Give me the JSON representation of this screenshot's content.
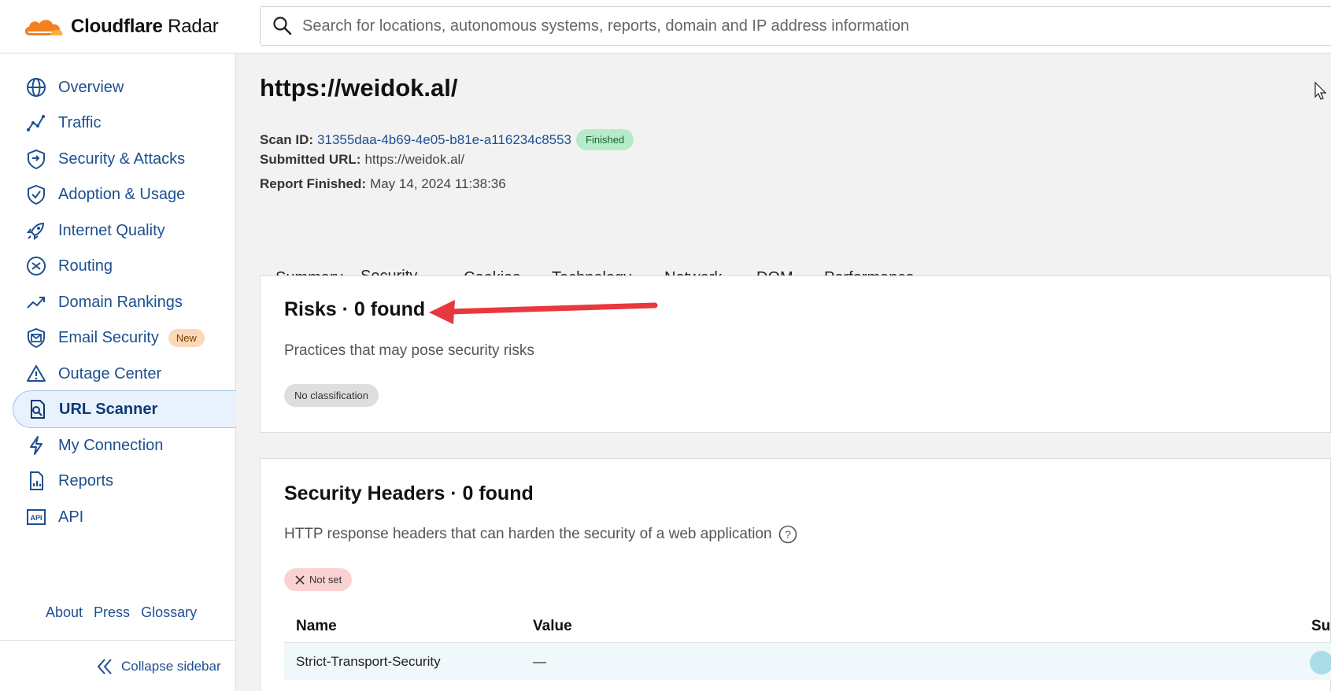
{
  "header": {
    "logo_bold": "Cloudflare",
    "logo_light": "Radar",
    "search_placeholder": "Search for locations, autonomous systems, reports, domain and IP address information"
  },
  "sidebar": {
    "items": [
      {
        "label": "Overview",
        "icon": "globe-icon"
      },
      {
        "label": "Traffic",
        "icon": "traffic-chart-icon"
      },
      {
        "label": "Security & Attacks",
        "icon": "shield-attack-icon"
      },
      {
        "label": "Adoption & Usage",
        "icon": "shield-check-icon"
      },
      {
        "label": "Internet Quality",
        "icon": "rocket-icon"
      },
      {
        "label": "Routing",
        "icon": "routing-icon"
      },
      {
        "label": "Domain Rankings",
        "icon": "trend-up-icon"
      },
      {
        "label": "Email Security",
        "icon": "email-shield-icon",
        "badge": "New"
      },
      {
        "label": "Outage Center",
        "icon": "warning-icon"
      },
      {
        "label": "URL Scanner",
        "icon": "url-scan-icon",
        "active": true
      },
      {
        "label": "My Connection",
        "icon": "lightning-icon"
      },
      {
        "label": "Reports",
        "icon": "report-icon"
      },
      {
        "label": "API",
        "icon": "api-icon"
      }
    ],
    "footer_links": [
      "About",
      "Press",
      "Glossary"
    ],
    "collapse_label": "Collapse sidebar"
  },
  "scan": {
    "title": "https://weidok.al/",
    "scan_id_label": "Scan ID:",
    "scan_id": "31355daa-4b69-4e05-b81e-a116234c8553",
    "status": "Finished",
    "submitted_label": "Submitted URL:",
    "submitted_url": "https://weidok.al/",
    "finished_label": "Report Finished:",
    "finished_at": "May 14, 2024 11:38:36"
  },
  "tabs": [
    "Summary",
    "Security",
    "Cookies",
    "Technology",
    "Network",
    "DOM",
    "Performance"
  ],
  "active_tab": "Security",
  "risks": {
    "title": "Risks · 0 found",
    "description": "Practices that may pose security risks",
    "chip": "No classification"
  },
  "security_headers": {
    "title": "Security Headers · 0 found",
    "description": "HTTP response headers that can harden the security of a web application",
    "chip": "Not set",
    "columns": [
      "Name",
      "Value",
      "Su"
    ],
    "rows": [
      {
        "name": "Strict-Transport-Security",
        "value": "—"
      }
    ]
  },
  "colors": {
    "accent": "#1d4f91",
    "annotation_arrow": "#e8383d",
    "finished_pill": "#b5ebc9",
    "not_set_chip": "#fbd2d2"
  }
}
